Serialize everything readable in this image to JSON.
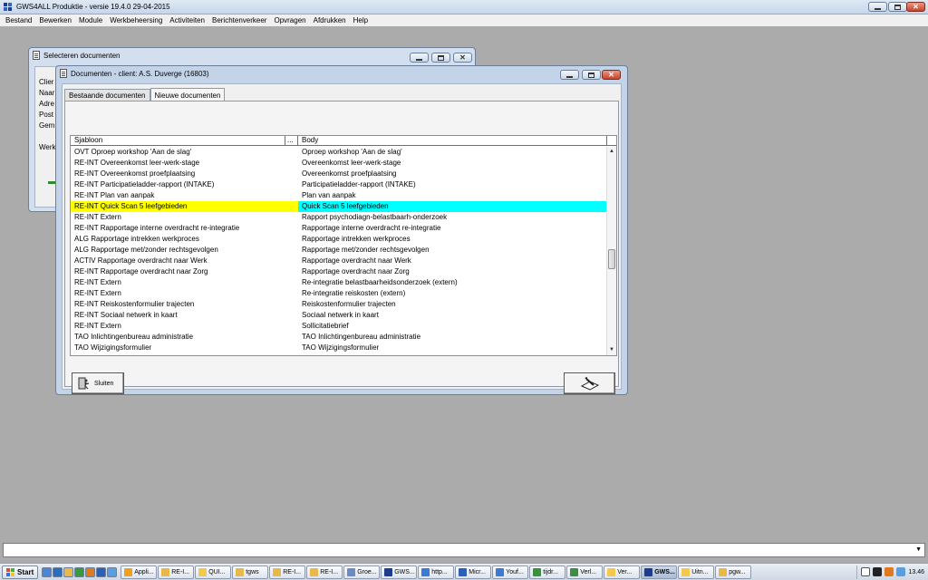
{
  "app": {
    "title": "GWS4ALL Produktie - versie 19.4.0   29-04-2015"
  },
  "menu": [
    "Bestand",
    "Bewerken",
    "Module",
    "Werkbeheersing",
    "Activiteiten",
    "Berichtenverkeer",
    "Opvragen",
    "Afdrukken",
    "Help"
  ],
  "background_window": {
    "title": "Selecteren documenten",
    "labels": [
      "Clier",
      "Naar",
      "Adre",
      "Post",
      "Gem",
      "Werk"
    ]
  },
  "documents_window": {
    "title": "Documenten - client: A.S. Duverge (16803)",
    "tabs": [
      {
        "label": "Bestaande documenten",
        "active": false
      },
      {
        "label": "Nieuwe documenten",
        "active": true
      }
    ],
    "columns": {
      "sjabloon": "Sjabloon",
      "dots": "...",
      "body": "Body"
    },
    "rows": [
      {
        "sjabloon": "OVT Oproep workshop 'Aan de slag'",
        "body": "Oproep workshop 'Aan de slag'"
      },
      {
        "sjabloon": "RE-INT Overeenkomst leer-werk-stage",
        "body": "Overeenkomst leer-werk-stage"
      },
      {
        "sjabloon": "RE-INT Overeenkomst proefplaatsing",
        "body": "Overeenkomst proefplaatsing"
      },
      {
        "sjabloon": "RE-INT Participatieladder-rapport (INTAKE)",
        "body": "Participatieladder-rapport (INTAKE)"
      },
      {
        "sjabloon": "RE-INT Plan van aanpak",
        "body": "Plan van aanpak"
      },
      {
        "sjabloon": "RE-INT Quick Scan 5 leefgebieden",
        "body": "Quick Scan 5 leefgebieden",
        "selected": true
      },
      {
        "sjabloon": "RE-INT Extern",
        "body": "Rapport psychodiagn-belastbaarh-onderzoek"
      },
      {
        "sjabloon": "RE-INT Rapportage interne overdracht re-integratie",
        "body": "Rapportage interne overdracht re-integratie"
      },
      {
        "sjabloon": "ALG Rapportage intrekken werkproces",
        "body": "Rapportage intrekken werkproces"
      },
      {
        "sjabloon": "ALG Rapportage met/zonder rechtsgevolgen",
        "body": "Rapportage met/zonder rechtsgevolgen"
      },
      {
        "sjabloon": "ACTIV Rapportage overdracht naar Werk",
        "body": "Rapportage overdracht naar Werk"
      },
      {
        "sjabloon": "RE-INT Rapportage overdracht naar Zorg",
        "body": "Rapportage overdracht naar Zorg"
      },
      {
        "sjabloon": "RE-INT Extern",
        "body": "Re-integratie belastbaarheidsonderzoek (extern)"
      },
      {
        "sjabloon": "RE-INT Extern",
        "body": "Re-integratie reiskosten (extern)"
      },
      {
        "sjabloon": "RE-INT Reiskostenformulier trajecten",
        "body": "Reiskostenformulier trajecten"
      },
      {
        "sjabloon": "RE-INT Sociaal netwerk in kaart",
        "body": "Sociaal netwerk in kaart"
      },
      {
        "sjabloon": "RE-INT Extern",
        "body": "Sollicitatiebrief"
      },
      {
        "sjabloon": "TAO Inlichtingenbureau administratie",
        "body": "TAO Inlichtingenbureau administratie"
      },
      {
        "sjabloon": "TAO Wijzigingsformulier",
        "body": "TAO Wijzigingsformulier"
      }
    ],
    "close_button": "Sluiten",
    "scroll_fraction": 0.55
  },
  "taskbar": {
    "start": "Start",
    "tasks": [
      {
        "label": "Appli...",
        "color": "#f0a020"
      },
      {
        "label": "RE-I...",
        "color": "#e8b84a"
      },
      {
        "label": "QUI...",
        "color": "#f2c94c"
      },
      {
        "label": "tgws",
        "color": "#e8b84a"
      },
      {
        "label": "RE-I...",
        "color": "#e8b84a"
      },
      {
        "label": "RE-I...",
        "color": "#e8b84a"
      },
      {
        "label": "Groe...",
        "color": "#6a8cc4"
      },
      {
        "label": "GWS...",
        "color": "#1d3c8f"
      },
      {
        "label": "http...",
        "color": "#3a7bd5"
      },
      {
        "label": "Micr...",
        "color": "#2b5fb8"
      },
      {
        "label": "Youf...",
        "color": "#3a7bd5"
      },
      {
        "label": "tijdr...",
        "color": "#3e8e41"
      },
      {
        "label": "Verl...",
        "color": "#3e8e41"
      },
      {
        "label": "Ver...",
        "color": "#f2c94c"
      },
      {
        "label": "GWS...",
        "color": "#1d3c8f",
        "active": true
      },
      {
        "label": "Uitn...",
        "color": "#f2c94c"
      },
      {
        "label": "pgw...",
        "color": "#e8b84a"
      }
    ],
    "clock": "13.46"
  },
  "colors": {
    "selected_sjabloon": "#ffff00",
    "selected_body": "#00ffff",
    "desktop": "#ababab"
  }
}
